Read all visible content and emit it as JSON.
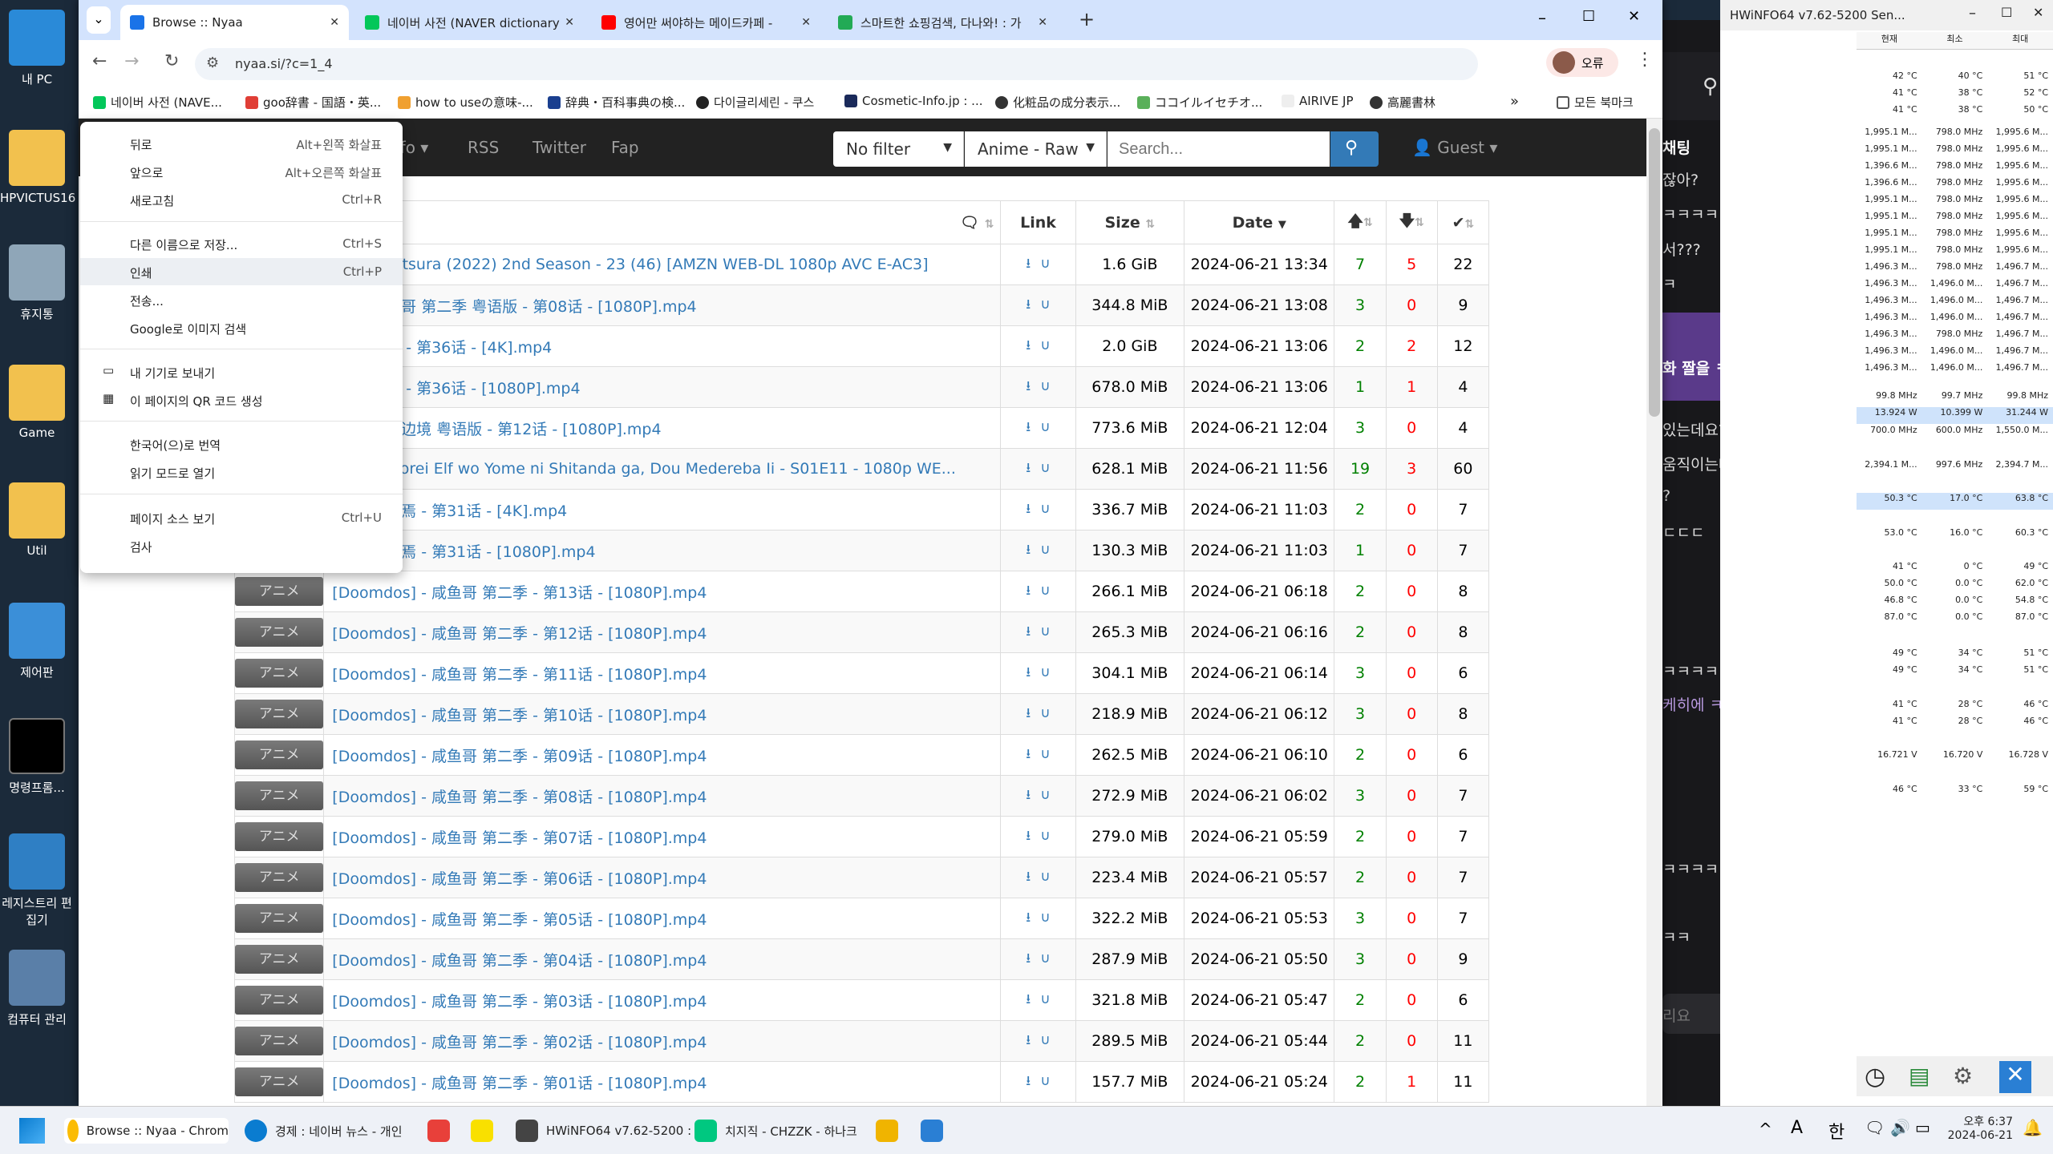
{
  "desktop": {
    "icons": [
      "내 PC",
      "HPVICTUS16",
      "휴지통",
      "Game",
      "Util",
      "제어판",
      "명령프롬...",
      "레지스트리 편집기",
      "컴퓨터 관리"
    ]
  },
  "browser": {
    "tabs": [
      {
        "title": "Browse :: Nyaa",
        "color": "#1a73e8"
      },
      {
        "title": "네이버 사전 (NAVER dictionary",
        "color": "#03c75a"
      },
      {
        "title": "영어만 써야하는 메이드카페 -",
        "color": "#ff0000"
      },
      {
        "title": "스마트한 쇼핑검색, 다나와! : 가",
        "color": "#22aa55"
      }
    ],
    "url": "nyaa.si/?c=1_4",
    "profile": "오류",
    "bookmarks": [
      "네이버 사전 (NAVE...",
      "goo辞書 - 国語・英...",
      "how to useの意味-...",
      "辞典・百科事典の検...",
      "다이글리세린 - 쿠스",
      "Cosmetic-Info.jp : ...",
      "化粧品の成分表示...",
      "ココイルイセチオ...",
      "AIRIVE JP",
      "高麗書林",
      "모든 북마크"
    ]
  },
  "nyaa": {
    "nav": [
      "nfo ▾",
      "RSS",
      "Twitter",
      "Fap"
    ],
    "filter": "No filter",
    "category": "Anime - Raw",
    "search_placeholder": "Search...",
    "guest": "Guest",
    "headers": {
      "link": "Link",
      "size": "Size",
      "date": "Date"
    },
    "rows": [
      {
        "name": "Urusei Yatsura (2022) 2nd Season - 23 (46) [AMZN WEB-DL 1080p AVC E-AC3]",
        "size": "1.6 GiB",
        "date": "2024-06-21 13:34",
        "s": "7",
        "l": "5",
        "c": "22"
      },
      {
        "name": "os] - 咸鱼哥 第二季 粤语版 - 第08话 - [1080P].mp4",
        "size": "344.8 MiB",
        "date": "2024-06-21 13:08",
        "s": "3",
        "l": "0",
        "c": "9"
      },
      {
        "name": "os] - 永生 - 第36话 - [4K].mp4",
        "size": "2.0 GiB",
        "date": "2024-06-21 13:06",
        "s": "2",
        "l": "2",
        "c": "12"
      },
      {
        "name": "os] - 永生 - 第36话 - [1080P].mp4",
        "size": "678.0 MiB",
        "date": "2024-06-21 13:06",
        "s": "1",
        "l": "1",
        "c": "4"
      },
      {
        "name": "os] - 虚无边境 粤语版 - 第12话 - [1080P].mp4",
        "size": "773.6 MiB",
        "date": "2024-06-21 12:04",
        "s": "3",
        "l": "0",
        "c": "4"
      },
      {
        "name": "Ore ga Dorei Elf wo Yome ni Shitanda ga, Dou Medereba Ii - S01E11 - 1080p WE...",
        "size": "628.1 MiB",
        "date": "2024-06-21 11:56",
        "s": "19",
        "l": "3",
        "c": "60"
      },
      {
        "name": "os] - 有兽焉 - 第31话 - [4K].mp4",
        "size": "336.7 MiB",
        "date": "2024-06-21 11:03",
        "s": "2",
        "l": "0",
        "c": "7"
      },
      {
        "name": "os] - 有兽焉 - 第31话 - [1080P].mp4",
        "size": "130.3 MiB",
        "date": "2024-06-21 11:03",
        "s": "1",
        "l": "0",
        "c": "7"
      },
      {
        "name": "[Doomdos] - 咸鱼哥 第二季 - 第13话 - [1080P].mp4",
        "size": "266.1 MiB",
        "date": "2024-06-21 06:18",
        "s": "2",
        "l": "0",
        "c": "8"
      },
      {
        "name": "[Doomdos] - 咸鱼哥 第二季 - 第12话 - [1080P].mp4",
        "size": "265.3 MiB",
        "date": "2024-06-21 06:16",
        "s": "2",
        "l": "0",
        "c": "8"
      },
      {
        "name": "[Doomdos] - 咸鱼哥 第二季 - 第11话 - [1080P].mp4",
        "size": "304.1 MiB",
        "date": "2024-06-21 06:14",
        "s": "3",
        "l": "0",
        "c": "6"
      },
      {
        "name": "[Doomdos] - 咸鱼哥 第二季 - 第10话 - [1080P].mp4",
        "size": "218.9 MiB",
        "date": "2024-06-21 06:12",
        "s": "3",
        "l": "0",
        "c": "8"
      },
      {
        "name": "[Doomdos] - 咸鱼哥 第二季 - 第09话 - [1080P].mp4",
        "size": "262.5 MiB",
        "date": "2024-06-21 06:10",
        "s": "2",
        "l": "0",
        "c": "6"
      },
      {
        "name": "[Doomdos] - 咸鱼哥 第二季 - 第08话 - [1080P].mp4",
        "size": "272.9 MiB",
        "date": "2024-06-21 06:02",
        "s": "3",
        "l": "0",
        "c": "7"
      },
      {
        "name": "[Doomdos] - 咸鱼哥 第二季 - 第07话 - [1080P].mp4",
        "size": "279.0 MiB",
        "date": "2024-06-21 05:59",
        "s": "2",
        "l": "0",
        "c": "7"
      },
      {
        "name": "[Doomdos] - 咸鱼哥 第二季 - 第06话 - [1080P].mp4",
        "size": "223.4 MiB",
        "date": "2024-06-21 05:57",
        "s": "2",
        "l": "0",
        "c": "7"
      },
      {
        "name": "[Doomdos] - 咸鱼哥 第二季 - 第05话 - [1080P].mp4",
        "size": "322.2 MiB",
        "date": "2024-06-21 05:53",
        "s": "3",
        "l": "0",
        "c": "7"
      },
      {
        "name": "[Doomdos] - 咸鱼哥 第二季 - 第04话 - [1080P].mp4",
        "size": "287.9 MiB",
        "date": "2024-06-21 05:50",
        "s": "3",
        "l": "0",
        "c": "9"
      },
      {
        "name": "[Doomdos] - 咸鱼哥 第二季 - 第03话 - [1080P].mp4",
        "size": "321.8 MiB",
        "date": "2024-06-21 05:47",
        "s": "2",
        "l": "0",
        "c": "6"
      },
      {
        "name": "[Doomdos] - 咸鱼哥 第二季 - 第02话 - [1080P].mp4",
        "size": "289.5 MiB",
        "date": "2024-06-21 05:44",
        "s": "2",
        "l": "0",
        "c": "11"
      },
      {
        "name": "[Doomdos] - 咸鱼哥 第二季 - 第01话 - [1080P].mp4",
        "size": "157.7 MiB",
        "date": "2024-06-21 05:24",
        "s": "2",
        "l": "1",
        "c": "11"
      }
    ],
    "cat_label": "アニメ"
  },
  "context_menu": [
    {
      "label": "뒤로",
      "shortcut": "Alt+왼쪽 화살표"
    },
    {
      "label": "앞으로",
      "shortcut": "Alt+오른쪽 화살표"
    },
    {
      "label": "새로고침",
      "shortcut": "Ctrl+R"
    },
    {
      "label": "다른 이름으로 저장...",
      "shortcut": "Ctrl+S"
    },
    {
      "label": "인쇄",
      "shortcut": "Ctrl+P"
    },
    {
      "label": "전송...",
      "shortcut": ""
    },
    {
      "label": "Google로 이미지 검색",
      "shortcut": ""
    },
    {
      "label": "내 기기로 보내기",
      "shortcut": ""
    },
    {
      "label": "이 페이지의 QR 코드 생성",
      "shortcut": ""
    },
    {
      "label": "한국어(으)로 번역",
      "shortcut": ""
    },
    {
      "label": "읽기 모드로 열기",
      "shortcut": ""
    },
    {
      "label": "페이지 소스 보기",
      "shortcut": "Ctrl+U"
    },
    {
      "label": "검사",
      "shortcut": ""
    }
  ],
  "chat": {
    "header": "채팅",
    "messages": [
      "잖아?",
      "ㅋㅋㅋㅋㅋㅋ",
      "서???",
      "ㅋ",
      "화 짤을 ㅋㅋㅋ",
      "있는데요?",
      "움직이는데???",
      "?",
      "ㄷㄷㄷ",
      "ㅋㅋㅋㅋㅋㅋㅋ",
      "케히에 ㅋㅋㅋㅋㅋㅋㅋㅋ",
      "ㅋㅋㅋㅋㅋㅋㅋ",
      "ㅋㅋ"
    ],
    "input_placeholder": "리요",
    "send": "채팅"
  },
  "hwinfo": {
    "title": "HWiNFO64 v7.62-5200 Sen...",
    "headers": [
      "현재",
      "최소",
      "최대"
    ],
    "rows": [
      [
        "42 °C",
        "40 °C",
        "51 °C"
      ],
      [
        "41 °C",
        "38 °C",
        "52 °C"
      ],
      [
        "41 °C",
        "38 °C",
        "50 °C"
      ],
      [
        "1,995.1 M...",
        "798.0 MHz",
        "1,995.6 M..."
      ],
      [
        "1,995.1 M...",
        "798.0 MHz",
        "1,995.6 M..."
      ],
      [
        "1,396.6 M...",
        "798.0 MHz",
        "1,995.6 M..."
      ],
      [
        "1,396.6 M...",
        "798.0 MHz",
        "1,995.6 M..."
      ],
      [
        "1,995.1 M...",
        "798.0 MHz",
        "1,995.6 M..."
      ],
      [
        "1,995.1 M...",
        "798.0 MHz",
        "1,995.6 M..."
      ],
      [
        "1,995.1 M...",
        "798.0 MHz",
        "1,995.6 M..."
      ],
      [
        "1,995.1 M...",
        "798.0 MHz",
        "1,995.6 M..."
      ],
      [
        "1,496.3 M...",
        "798.0 MHz",
        "1,496.7 M..."
      ],
      [
        "1,496.3 M...",
        "1,496.0 M...",
        "1,496.7 M..."
      ],
      [
        "1,496.3 M...",
        "1,496.0 M...",
        "1,496.7 M..."
      ],
      [
        "1,496.3 M...",
        "1,496.0 M...",
        "1,496.7 M..."
      ],
      [
        "1,496.3 M...",
        "798.0 MHz",
        "1,496.7 M..."
      ],
      [
        "1,496.3 M...",
        "1,496.0 M...",
        "1,496.7 M..."
      ],
      [
        "1,496.3 M...",
        "1,496.0 M...",
        "1,496.7 M..."
      ],
      [
        "99.8 MHz",
        "99.7 MHz",
        "99.8 MHz"
      ],
      [
        "13.924 W",
        "10.399 W",
        "31.244 W"
      ],
      [
        "700.0 MHz",
        "600.0 MHz",
        "1,550.0 M..."
      ],
      [
        "2,394.1 M...",
        "997.6 MHz",
        "2,394.7 M..."
      ],
      [
        "50.3 °C",
        "17.0 °C",
        "63.8 °C"
      ],
      [
        "53.0 °C",
        "16.0 °C",
        "60.3 °C"
      ],
      [
        "41 °C",
        "0 °C",
        "49 °C"
      ],
      [
        "50.0 °C",
        "0.0 °C",
        "62.0 °C"
      ],
      [
        "46.8 °C",
        "0.0 °C",
        "54.8 °C"
      ],
      [
        "87.0 °C",
        "0.0 °C",
        "87.0 °C"
      ],
      [
        "49 °C",
        "34 °C",
        "51 °C"
      ],
      [
        "49 °C",
        "34 °C",
        "51 °C"
      ],
      [
        "41 °C",
        "28 °C",
        "46 °C"
      ],
      [
        "41 °C",
        "28 °C",
        "46 °C"
      ],
      [
        "16.721 V",
        "16.720 V",
        "16.728 V"
      ],
      [
        "46 °C",
        "33 °C",
        "59 °C"
      ]
    ]
  },
  "taskbar": {
    "apps": [
      {
        "label": "Browse :: Nyaa - Chrom",
        "color": "#fbbc04"
      },
      {
        "label": "경제 : 네이버 뉴스 - 개인",
        "color": "#0a7cd0"
      },
      {
        "label": "",
        "color": "#e8403a"
      },
      {
        "label": "",
        "color": "#f9e000"
      },
      {
        "label": "HWiNFO64 v7.62-5200 :",
        "color": "#444"
      },
      {
        "label": "치지직 - CHZZK - 하나크",
        "color": "#00c880"
      },
      {
        "label": "",
        "color": "#f0b400"
      },
      {
        "label": "",
        "color": "#2a7fd4"
      }
    ],
    "time": "오후 6:37",
    "date": "2024-06-21",
    "ime": "한",
    "lang": "A"
  }
}
